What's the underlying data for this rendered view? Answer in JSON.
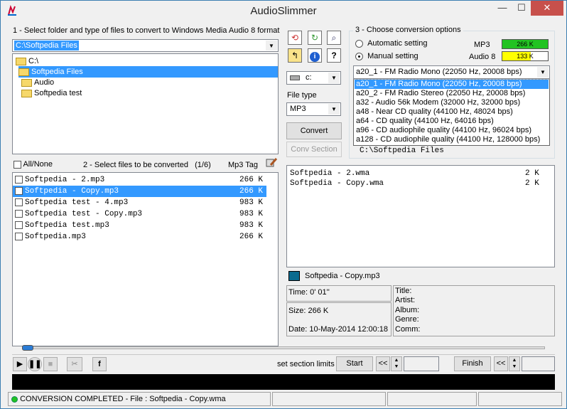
{
  "app_title": "AudioSlimmer",
  "window_controls": {
    "minimize": "—",
    "maximize": "☐",
    "close": "✕"
  },
  "section1": {
    "label": "1 - Select folder and type of files to convert to Windows Media Audio 8 format",
    "folder_path": "C:\\Softpedia Files",
    "tree": [
      {
        "label": "C:\\"
      },
      {
        "label": "Softpedia Files"
      },
      {
        "label": "Audio"
      },
      {
        "label": "Softpedia test"
      }
    ]
  },
  "section2": {
    "all_none": "All/None",
    "label": "2 - Select files to be converted   (1/6)",
    "mp3tag": "Mp3 Tag",
    "files": [
      {
        "name": "Softpedia - 2.mp3",
        "size": "266 K"
      },
      {
        "name": "Softpedia - Copy.mp3",
        "size": "266 K"
      },
      {
        "name": "Softpedia test - 4.mp3",
        "size": "983 K"
      },
      {
        "name": "Softpedia test - Copy.mp3",
        "size": "983 K"
      },
      {
        "name": "Softpedia test.mp3",
        "size": "983 K"
      },
      {
        "name": "Softpedia.mp3",
        "size": "266 K"
      }
    ]
  },
  "middle": {
    "drive": "c:",
    "file_type_label": "File type",
    "file_type": "MP3",
    "convert": "Convert",
    "conv_section": "Conv Section"
  },
  "section3": {
    "label": "3 - Choose conversion options",
    "automatic": "Automatic setting",
    "manual": "Manual setting",
    "mp3_label": "MP3",
    "mp3_size": "266 K",
    "audio8_label": "Audio 8",
    "audio8_size": "133 K",
    "audio8_fill": 0.62,
    "selected_option": "a20_1 - FM Radio Mono (22050 Hz, 20008 bps)",
    "options": [
      "a20_1 - FM Radio Mono (22050 Hz, 20008 bps)",
      "a20_2 - FM Radio Stereo (22050 Hz, 20008 bps)",
      "a32 - Audio 56k Modem (32000 Hz, 32000 bps)",
      "a48 - Near CD quality (44100 Hz, 48024 bps)",
      "a64 - CD quality (44100 Hz, 64016 bps)",
      "a96 - CD audiophile quality (44100 Hz, 96024 bps)",
      "a128 - CD audiophile quality (44100 Hz, 128000 bps)"
    ],
    "output_path": "C:\\Softpedia Files"
  },
  "output_files": [
    {
      "name": "Softpedia - 2.wma",
      "size": "2 K"
    },
    {
      "name": "Softpedia - Copy.wma",
      "size": "2 K"
    }
  ],
  "info": {
    "filename": "Softpedia - Copy.mp3",
    "time": "Time: 0' 01''",
    "size": "Size: 266 K",
    "date": "Date: 10-May-2014 12:00:18",
    "tags": [
      "Title:",
      "Artist:",
      "Album:",
      "Genre:",
      "Comm:"
    ]
  },
  "player": {
    "set_section": "set section limits",
    "start": "Start",
    "finish": "Finish",
    "rewind": "<<",
    "forward": ">>"
  },
  "status": {
    "text": "CONVERSION COMPLETED - File : Softpedia - Copy.wma",
    "led_color": "#22c322"
  },
  "colors": {
    "mp3_bar": "#22c322",
    "audio8_bar": "#ffff00",
    "selection": "#3399ff"
  }
}
